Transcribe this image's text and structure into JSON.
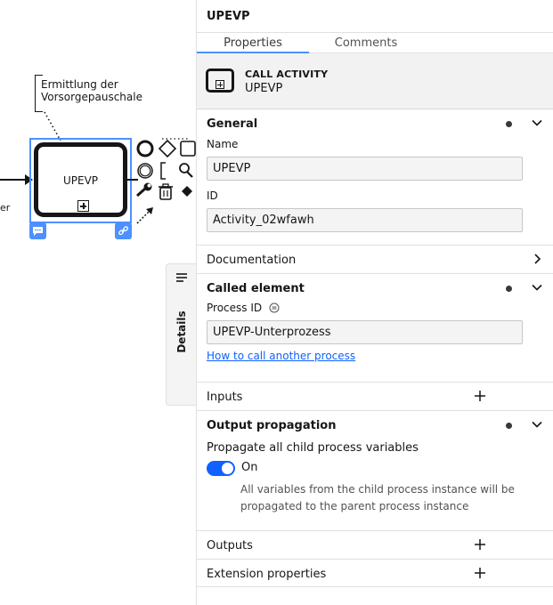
{
  "canvas": {
    "annotation": "Ermittlung der Vorsorgepauschale",
    "task_label": "UPEVP",
    "incoming_label_fragment": "er"
  },
  "details_tab": {
    "label": "Details"
  },
  "panel": {
    "title": "UPEVP",
    "tabs": [
      {
        "label": "Properties",
        "active": true
      },
      {
        "label": "Comments",
        "active": false
      }
    ],
    "element": {
      "type": "CALL ACTIVITY",
      "name": "UPEVP"
    },
    "groups": {
      "general": {
        "title": "General",
        "name_label": "Name",
        "name_value": "UPEVP",
        "id_label": "ID",
        "id_value": "Activity_02wfawh"
      },
      "documentation": {
        "title": "Documentation"
      },
      "called_element": {
        "title": "Called element",
        "process_id_label": "Process ID",
        "process_id_value": "UPEVP-Unterprozess",
        "help_link": "How to call another process"
      },
      "inputs": {
        "title": "Inputs"
      },
      "output_propagation": {
        "title": "Output propagation",
        "checkbox_label": "Propagate all child process variables",
        "toggle_state": "On",
        "hint": "All variables from the child process instance will be propagated to the parent process instance"
      },
      "outputs": {
        "title": "Outputs"
      },
      "extension_properties": {
        "title": "Extension properties"
      }
    }
  },
  "colors": {
    "selection": "#4d90ff",
    "toggle_on": "#0f62fe",
    "link": "#0f62fe",
    "header_bg": "#f2f2f2"
  }
}
